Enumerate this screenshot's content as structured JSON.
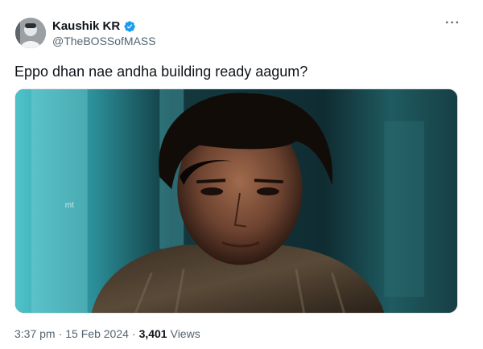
{
  "author": {
    "display_name": "Kaushik KR",
    "handle": "@TheBOSSofMASS",
    "verified": true
  },
  "tweet": {
    "text": "Eppo dhan nae andha building ready aagum?",
    "media_watermark": "mt",
    "timestamp": "3:37 pm",
    "separator": "·",
    "date": "15 Feb 2024",
    "views_count": "3,401",
    "views_label": "Views"
  },
  "icons": {
    "verified": "verified-badge-icon",
    "more": "more-options-icon"
  },
  "colors": {
    "verified_blue": "#1d9bf0",
    "secondary_text": "#536471",
    "primary_text": "#0f1419"
  }
}
